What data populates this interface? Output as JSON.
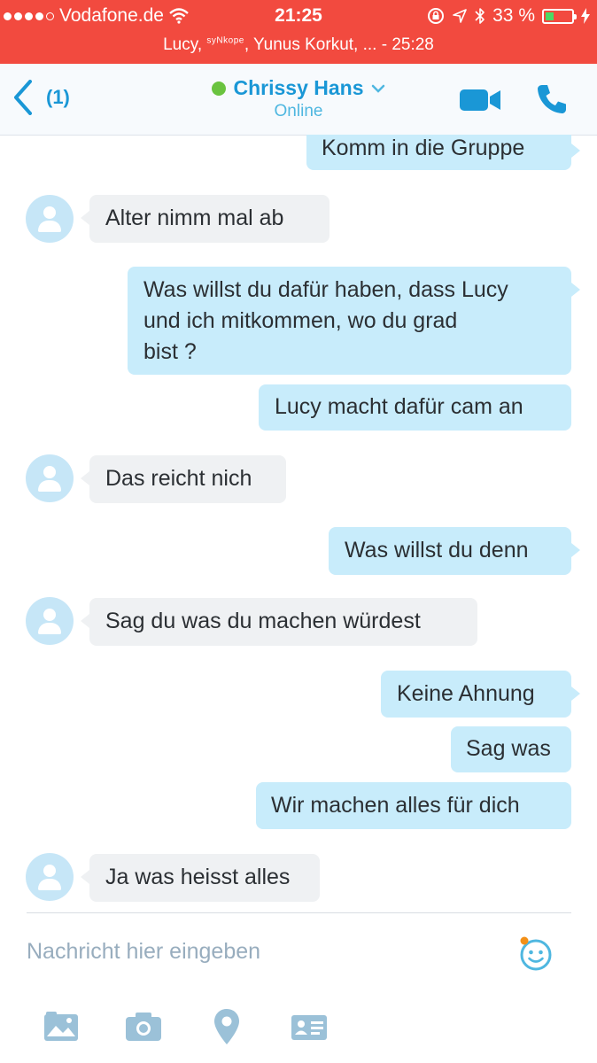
{
  "status_bar": {
    "carrier": "Vodafone.de",
    "time": "21:25",
    "battery": "33 %",
    "battery_level": 0.33,
    "call_banner": {
      "name1": "Lucy,",
      "sup": "syNkope",
      "rest": ", Yunus Korkut, ... - 25:28"
    }
  },
  "header": {
    "back_count": "(1)",
    "contact_name": "Chrissy Hans",
    "contact_status": "Online"
  },
  "messages": [
    {
      "dir": "out",
      "text": "Komm in die Gruppe"
    },
    {
      "dir": "in",
      "text": "Alter nimm mal ab"
    },
    {
      "dir": "out",
      "lines": [
        "Was willst du dafür haben, dass Lucy",
        "und ich mitkommen, wo du grad",
        "bist ?"
      ]
    },
    {
      "dir": "out",
      "text": "Lucy macht dafür cam an"
    },
    {
      "dir": "in",
      "text": "Das reicht nich"
    },
    {
      "dir": "out",
      "text": "Was willst du denn"
    },
    {
      "dir": "in",
      "text": "Sag du was du machen würdest"
    },
    {
      "dir": "out",
      "text": "Keine Ahnung"
    },
    {
      "dir": "out",
      "text": "Sag was"
    },
    {
      "dir": "out",
      "text": "Wir machen alles für dich"
    },
    {
      "dir": "in",
      "text": "Ja was heisst alles"
    }
  ],
  "composer": {
    "placeholder": "Nachricht hier eingeben"
  },
  "toolbar_icons": [
    "gallery-icon",
    "camera-icon",
    "location-icon",
    "contact-card-icon"
  ],
  "colors": {
    "status_bar": "#f24a3f",
    "accent": "#1a97d6",
    "outgoing_bubble": "#c8ecfb",
    "incoming_bubble": "#eff1f3",
    "online": "#6ac33f"
  }
}
